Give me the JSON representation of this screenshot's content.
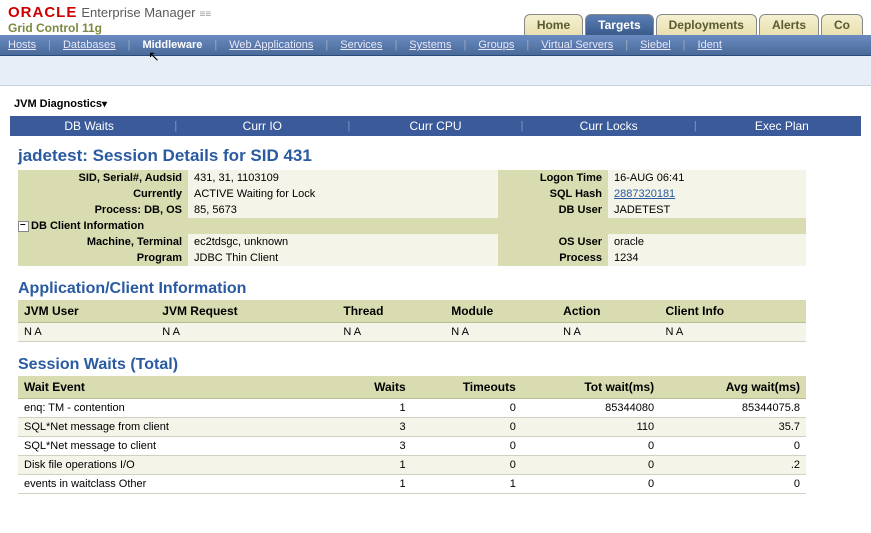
{
  "header": {
    "oracle": "ORACLE",
    "em": "Enterprise Manager",
    "gc": "Grid Control 11g"
  },
  "top_tabs": [
    "Home",
    "Targets",
    "Deployments",
    "Alerts",
    "Co"
  ],
  "top_active": 1,
  "sub_nav": [
    "Hosts",
    "Databases",
    "Middleware",
    "Web Applications",
    "Services",
    "Systems",
    "Groups",
    "Virtual Servers",
    "Siebel",
    "Ident"
  ],
  "sub_active": 2,
  "jvm_title": "JVM Diagnostics",
  "sub_tabs": [
    "DB Waits",
    "Curr IO",
    "Curr CPU",
    "Curr Locks",
    "Exec Plan"
  ],
  "page_title": "jadetest: Session Details for SID 431",
  "session": {
    "sid_label": "SID, Serial#, Audsid",
    "sid_val": "431, 31, 1103109",
    "logon_label": "Logon Time",
    "logon_val": "16-AUG 06:41",
    "cur_label": "Currently",
    "cur_val": "ACTIVE Waiting for Lock",
    "hash_label": "SQL Hash",
    "hash_val": "2887320181",
    "proc_label": "Process: DB, OS",
    "proc_val": "85, 5673",
    "dbuser_label": "DB User",
    "dbuser_val": "JADETEST",
    "client_hdr": "DB Client Information",
    "mach_label": "Machine, Terminal",
    "mach_val": "ec2tdsgc, unknown",
    "osuser_label": "OS User",
    "osuser_val": "oracle",
    "prog_label": "Program",
    "prog_val": "JDBC Thin Client",
    "proc2_label": "Process",
    "proc2_val": "1234"
  },
  "appinfo": {
    "title": "Application/Client Information",
    "cols": [
      "JVM User",
      "JVM Request",
      "Thread",
      "Module",
      "Action",
      "Client Info"
    ],
    "row": [
      "N A",
      "N A",
      "N A",
      "N A",
      "N A",
      "N A"
    ]
  },
  "waits": {
    "title": "Session Waits (Total)",
    "cols": [
      "Wait Event",
      "Waits",
      "Timeouts",
      "Tot wait(ms)",
      "Avg wait(ms)"
    ],
    "rows": [
      [
        "enq: TM - contention",
        "1",
        "0",
        "85344080",
        "85344075.8"
      ],
      [
        "SQL*Net message from client",
        "3",
        "0",
        "110",
        "35.7"
      ],
      [
        "SQL*Net message to client",
        "3",
        "0",
        "0",
        "0"
      ],
      [
        "Disk file operations I/O",
        "1",
        "0",
        "0",
        ".2"
      ],
      [
        "events in waitclass Other",
        "1",
        "1",
        "0",
        "0"
      ]
    ]
  }
}
